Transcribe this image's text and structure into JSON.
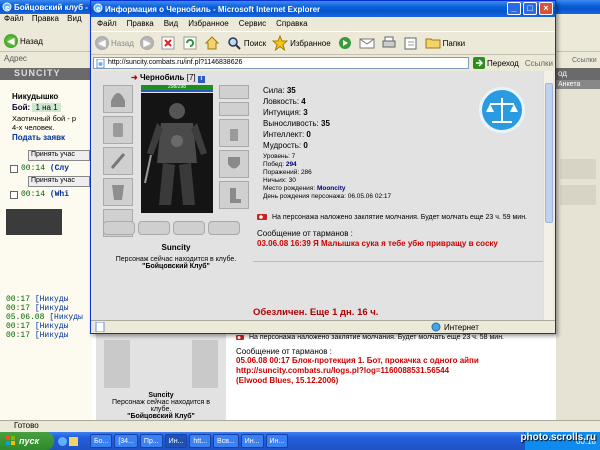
{
  "background": {
    "title": "Бойцовский клуб - ...",
    "menu": [
      "Файл",
      "Правка",
      "Вид"
    ],
    "back_label": "Назад",
    "address_label": "Адрес",
    "site_logo": "SUNCITY",
    "player_name": "Никудышко",
    "fight_label": "Бой:",
    "fight_value": "1 на 1",
    "fight_text1": "Хаотичный бой - р",
    "fight_text2": "4-х человек.",
    "submit_request": "Подать заявк",
    "accept_btn_1": "Принять учас",
    "accept_btn_2": "Принять учас",
    "row1_time": "00:14",
    "row1_name": "(Слу",
    "row2_time": "00:14",
    "row2_name": "(Whi",
    "chat": [
      {
        "t": "00:17",
        "n": "[Никуды"
      },
      {
        "t": "00:17",
        "n": "[Никуды"
      },
      {
        "t": "05.06.08",
        "n": "[Никуды"
      },
      {
        "t": "00:17",
        "n": "[Никуды"
      },
      {
        "t": "00:17",
        "n": "[Никуды"
      }
    ],
    "right_header": "од",
    "right_sub": "Анкета",
    "right_links": "Ссылки",
    "lower_silence": "На персонажа наложено заклятие молчания. Будет молчать еще 23 ч. 58 мин.",
    "lower_msg_title": "Сообщение от тарманов :",
    "lower_msg_line1": "05.06.08 00:17 Блок-протекция 1. Бот, прокачка с одного айпи",
    "lower_msg_line2": "http://suncity.combats.ru/logs.pl?log=1160088531.56544",
    "lower_msg_line3": "(Elwood Blues, 15.12.2006)",
    "lower_char_name": "Suncity",
    "lower_char_loc": "Персонаж сейчас находится в клубе.",
    "lower_char_club": "\"Бойцовский Клуб\"",
    "status_done": "Готово"
  },
  "popup": {
    "title": "Информация о Чернобиль - Microsoft Internet Explorer",
    "menu": [
      "Файл",
      "Правка",
      "Вид",
      "Избранное",
      "Сервис",
      "Справка"
    ],
    "toolbar": {
      "back": "Назад",
      "search": "Поиск",
      "favorites": "Избранное",
      "folders": "Папки"
    },
    "address": "http://suncity.combats.ru/inf.pl?1146838626",
    "go_label": "Переход",
    "links_label": "Ссылки",
    "status_zone": "Интернет",
    "character": {
      "name": "Чернобиль",
      "level_tag": "[7]",
      "hp": "298/298",
      "caption_name": "Suncity",
      "location": "Персонаж сейчас находится в клубе.",
      "club": "\"Бойцовский Клуб\""
    },
    "stats": [
      {
        "label": "Сила:",
        "value": "35"
      },
      {
        "label": "Ловкость:",
        "value": "4"
      },
      {
        "label": "Интуиция:",
        "value": "3"
      },
      {
        "label": "Выносливость:",
        "value": "35"
      },
      {
        "label": "Интеллект:",
        "value": "0"
      },
      {
        "label": "Мудрость:",
        "value": "0"
      }
    ],
    "details": {
      "level": "Уровень: 7",
      "wins_label": "Побед:",
      "wins": "294",
      "losses": "Поражений: 286",
      "draws": "Ничьих: 30",
      "birthplace_label": "Место рождения:",
      "birthplace": "Mooncity",
      "birthday": "День рождения персонажа: 06.05.06 02:17"
    },
    "silence": "На персонажа наложено заклятие молчания. Будет молчать еще 23 ч. 59 мин.",
    "msg_title": "Сообщение от тарманов :",
    "msg_text": "03.06.08 16:39 Я Малышка сука я тебе убю привращу в соску",
    "banned": "Обезличен. Еще 1 дн. 16 ч."
  },
  "taskbar": {
    "start": "пуск",
    "items": [
      "Бо...",
      "[34...",
      "Пр...",
      "Ин...",
      "htt...",
      "Всв...",
      "Ин...",
      "Ин..."
    ],
    "clock": "00:18"
  },
  "watermark": "photo.scrolls.ru",
  "colors": {
    "title_blue": "#0a5fd8",
    "message_red": "#cc0000",
    "banned_red": "#b00000",
    "hp_green": "#1c8f1c"
  }
}
